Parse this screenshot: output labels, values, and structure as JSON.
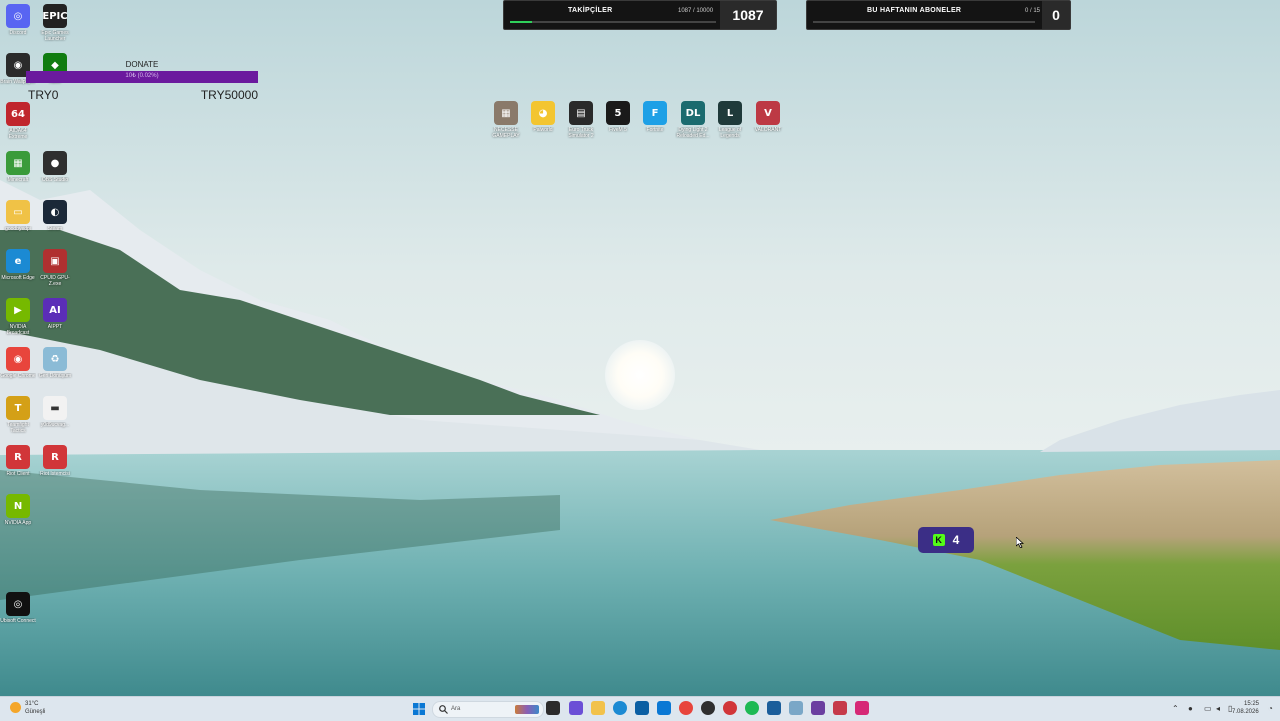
{
  "desktop_icons": [
    {
      "label": "Discord",
      "color": "#5865f2",
      "glyph": "◎"
    },
    {
      "label": "Epic Games Launcher",
      "color": "#222222",
      "glyph": "EPIC"
    },
    {
      "label": "Brain Wallpaper",
      "color": "#2b2b2b",
      "glyph": "◉"
    },
    {
      "label": "Xbox",
      "color": "#107c10",
      "glyph": "◆"
    },
    {
      "label": "AIDA64 Extreme",
      "color": "#c0262d",
      "glyph": "64"
    },
    {
      "label": "Minecraft",
      "color": "#3a9b3a",
      "glyph": "▦"
    },
    {
      "label": "OBS Studio",
      "color": "#2f2f2f",
      "glyph": "●"
    },
    {
      "label": "goodbyedpi",
      "color": "#f0c246",
      "glyph": "▭"
    },
    {
      "label": "Steam",
      "color": "#1b2838",
      "glyph": "◐"
    },
    {
      "label": "Microsoft Edge",
      "color": "#1b8ad3",
      "glyph": "e"
    },
    {
      "label": "CPUID GPU-Z.exe",
      "color": "#b03030",
      "glyph": "▣"
    },
    {
      "label": "NVIDIA Broadcast",
      "color": "#76b900",
      "glyph": "▶"
    },
    {
      "label": "AIPPT",
      "color": "#5b2db8",
      "glyph": "AI"
    },
    {
      "label": "Google Chrome",
      "color": "#e8453c",
      "glyph": "◉"
    },
    {
      "label": "Geri Dönüşüm",
      "color": "#8bbbd6",
      "glyph": "♻"
    },
    {
      "label": "Teamfight Tactics",
      "color": "#d4a017",
      "glyph": "T"
    },
    {
      "label": "y0d9ucvag...",
      "color": "#f2f2f2",
      "glyph": "▬"
    },
    {
      "label": "Riot Client",
      "color": "#d13639",
      "glyph": "R"
    },
    {
      "label": "Riot İstemcisi",
      "color": "#d13639",
      "glyph": "R"
    },
    {
      "label": "NVIDIA App",
      "color": "#76b900",
      "glyph": "N"
    },
    {
      "label": "Ubisoft Connect",
      "color": "#111111",
      "glyph": "◎"
    }
  ],
  "center_icons": [
    {
      "label": "NECESSE GAMEPLAY",
      "color": "#8a7a6a",
      "glyph": "▦"
    },
    {
      "label": "Palworld",
      "color": "#f3c530",
      "glyph": "◕"
    },
    {
      "label": "Euro Truck Simulator 2",
      "color": "#2a2a2a",
      "glyph": "▤"
    },
    {
      "label": "FiveM 5",
      "color": "#1a1a1a",
      "glyph": "5"
    },
    {
      "label": "Fortnite",
      "color": "#1ea0e6",
      "glyph": "F"
    },
    {
      "label": "Dying Light 2 Reloaded Ed...",
      "color": "#1b6b6f",
      "glyph": "DL"
    },
    {
      "label": "League of Legends",
      "color": "#1f3a3a",
      "glyph": "L"
    },
    {
      "label": "VALORANT",
      "color": "#bd3944",
      "glyph": "V"
    }
  ],
  "followers_widget": {
    "title": "TAKİPÇİLER",
    "count": "1087 / 10000",
    "value": "1087",
    "progress": 0.1087,
    "accent": "#2fcf5a"
  },
  "subs_widget": {
    "title": "BU HAFTANIN ABONELER",
    "count": "0 / 15",
    "value": "0",
    "progress": 0,
    "accent": "#7b52c9"
  },
  "donate": {
    "label": "DONATE",
    "percent_text": "10₺ (0.02%)",
    "min": "TRY0",
    "max": "TRY50000",
    "color": "#6b1a9e"
  },
  "kick_badge": {
    "value": "4",
    "color": "#53fc18"
  },
  "taskbar": {
    "weather_temp": "31°C",
    "weather_desc": "Güneşli",
    "search_placeholder": "Ara",
    "time": "15:25",
    "date": "7.08.2026"
  }
}
